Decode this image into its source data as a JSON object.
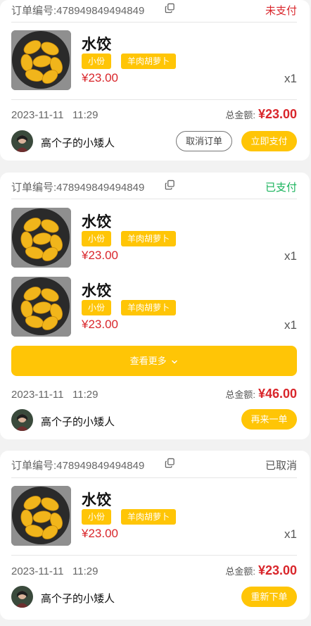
{
  "orders": [
    {
      "order_label": "订单编号:",
      "order_no": "478949849494849",
      "status": "未支付",
      "items": [
        {
          "name": "水饺",
          "tags": [
            "小份",
            "羊肉胡萝卜"
          ],
          "price": "¥23.00",
          "qty": "x1"
        }
      ],
      "date": "2023-11-11",
      "time": "11:29",
      "total_label": "总金额:",
      "total": "¥23.00",
      "user": "高个子的小矮人",
      "buttons": [
        "取消订单",
        "立即支付"
      ]
    },
    {
      "order_label": "订单编号:",
      "order_no": "478949849494849",
      "status": "已支付",
      "items": [
        {
          "name": "水饺",
          "tags": [
            "小份",
            "羊肉胡萝卜"
          ],
          "price": "¥23.00",
          "qty": "x1"
        },
        {
          "name": "水饺",
          "tags": [
            "小份",
            "羊肉胡萝卜"
          ],
          "price": "¥23.00",
          "qty": "x1"
        }
      ],
      "more_label": "查看更多",
      "date": "2023-11-11",
      "time": "11:29",
      "total_label": "总金额:",
      "total": "¥46.00",
      "user": "高个子的小矮人",
      "buttons": [
        "再来一单"
      ]
    },
    {
      "order_label": "订单编号:",
      "order_no": "478949849494849",
      "status": "已取消",
      "items": [
        {
          "name": "水饺",
          "tags": [
            "小份",
            "羊肉胡萝卜"
          ],
          "price": "¥23.00",
          "qty": "x1"
        }
      ],
      "date": "2023-11-11",
      "time": "11:29",
      "total_label": "总金额:",
      "total": "¥23.00",
      "user": "高个子的小矮人",
      "buttons": [
        "重新下单"
      ]
    }
  ],
  "colors": {
    "accent": "#ffc506",
    "price": "#d9262b",
    "status_unpaid": "#d9262b",
    "status_paid": "#18b35b",
    "status_cancelled": "#555555"
  },
  "icons": {
    "copy": "copy-icon",
    "chevron": "chevron-down-icon"
  }
}
